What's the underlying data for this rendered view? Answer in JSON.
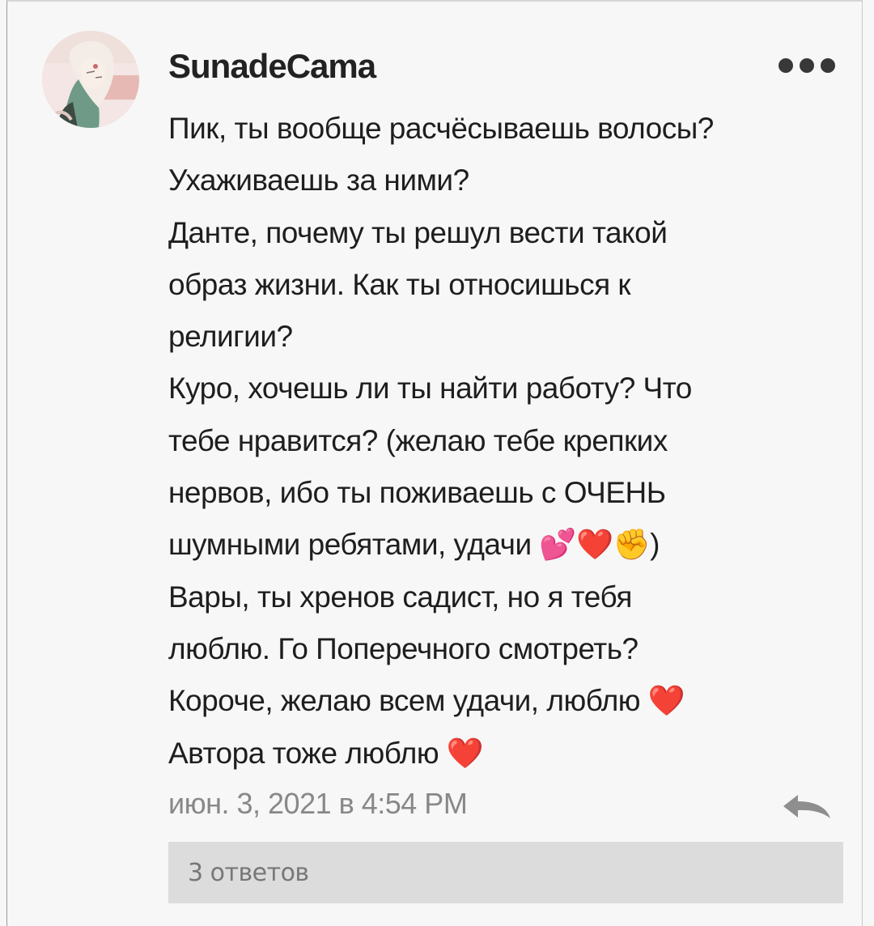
{
  "comment": {
    "username": "SunadeCama",
    "lines": [
      "Пик, ты вообще расчёсываешь волосы?",
      "Ухаживаешь за ними?",
      "Данте, почему ты решул вести такой",
      "образ жизни. Как ты относишься к",
      "религии?",
      "Куро, хочешь ли ты найти работу? Что",
      "тебе нравится? (желаю тебе крепких",
      "нервов, ибо ты поживаешь с ОЧЕНЬ",
      "шумными ребятами, удачи 💕❤️✊)",
      "Вары, ты хренов садист, но я тебя",
      "люблю. Го Поперечного смотреть?",
      "Короче, желаю всем удачи, люблю ❤️",
      "Автора тоже люблю ❤️"
    ],
    "timestamp": "июн. 3, 2021 в 4:54 PM",
    "replies_label": "3 ответов"
  },
  "icons": {
    "avatar": "user-avatar-anime-character",
    "more": "more-dots-icon",
    "reply": "reply-arrow-icon"
  }
}
